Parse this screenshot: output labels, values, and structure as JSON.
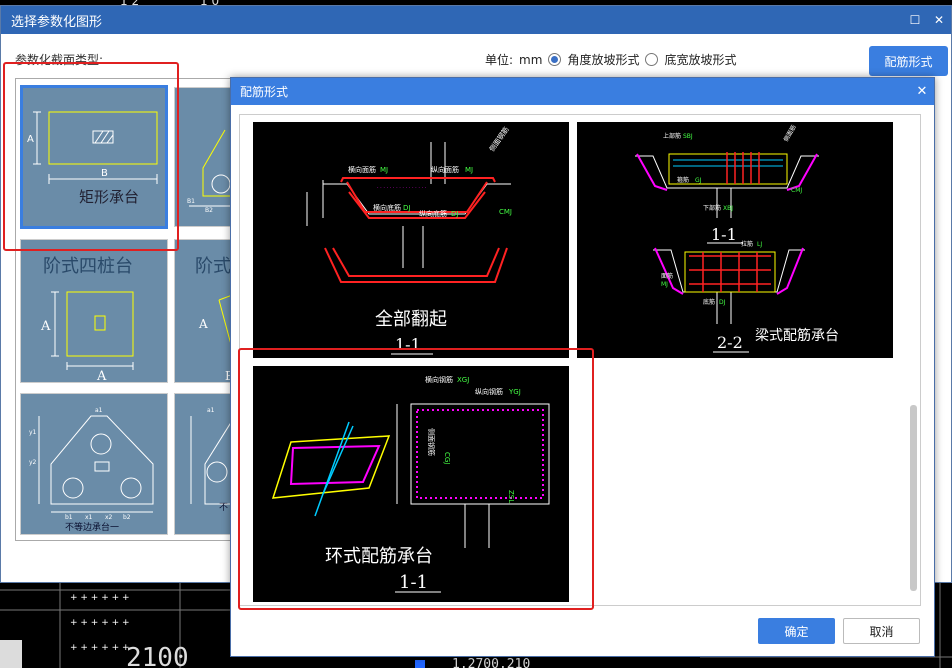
{
  "background": {
    "top_texts": [
      "1 2",
      "1 0"
    ],
    "bottom_labels": [
      "2100",
      "1.2700.210"
    ]
  },
  "main_window": {
    "title": "选择参数化图形",
    "controls": [
      "maximize-icon",
      "close-icon"
    ],
    "section_label": "参数化截面类型:",
    "unit_label": "单位:",
    "unit_value": "mm",
    "radio_options": [
      {
        "label": "角度放坡形式",
        "checked": true
      },
      {
        "label": "底宽放坡形式",
        "checked": false
      }
    ],
    "rebar_button": "配筋形式",
    "tiles": [
      {
        "name": "矩形承台",
        "selected": true,
        "letters": [
          "A",
          "B"
        ]
      },
      {
        "name": "",
        "letters": [
          "B1",
          "B2"
        ]
      },
      {
        "name": "阶式四桩台",
        "letters": [
          "A",
          "A"
        ]
      },
      {
        "name": "阶式",
        "letters": [
          "A",
          "B"
        ]
      },
      {
        "name": "不等边承台一",
        "letters": [
          "a1",
          "b1",
          "b2",
          "y1",
          "y2",
          "x1",
          "x2"
        ]
      },
      {
        "name": "不",
        "letters": [
          "a1"
        ]
      }
    ]
  },
  "rebar_dialog": {
    "title": "配筋形式",
    "ok": "确定",
    "cancel": "取消",
    "panels": [
      {
        "name": "全部翻起",
        "section": "1-1",
        "labels": [
          "横向面筋",
          "MJ",
          "纵向面筋",
          "MJ",
          "横向底筋",
          "DJ",
          "纵向底筋",
          "DJ",
          "侧面钢筋",
          "CMJ"
        ]
      },
      {
        "name": "梁式配筋承台",
        "sections": [
          "1-1",
          "2-2"
        ],
        "labels": [
          "上部筋",
          "SBJ",
          "下部筋",
          "XBJ",
          "侧面筋",
          "CMJ",
          "箍筋",
          "GJ",
          "拉筋",
          "LJ",
          "面筋",
          "MJ",
          "底筋",
          "DJ"
        ]
      },
      {
        "name": "环式配筋承台",
        "section": "1-1",
        "labels": [
          "横向钢筋",
          "XGJ",
          "纵向钢筋",
          "YGJ",
          "侧面钢筋",
          "CGJ",
          "ZSL"
        ]
      }
    ]
  }
}
